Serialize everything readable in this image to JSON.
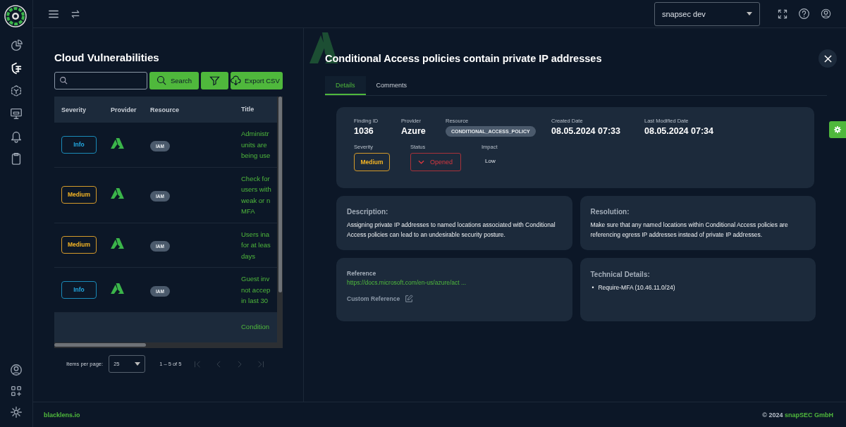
{
  "sidebar": {
    "items": [
      {
        "selected": false
      },
      {
        "selected": true
      },
      {
        "selected": false
      },
      {
        "selected": false
      },
      {
        "selected": false
      },
      {
        "selected": false
      }
    ]
  },
  "topbar": {
    "workspace": "snapsec dev"
  },
  "list": {
    "title": "Cloud Vulnerabilities",
    "search": {
      "button": "Search"
    },
    "export_button": "Export CSV",
    "columns": [
      "Severity",
      "Provider",
      "Resource",
      "Title"
    ],
    "rows": [
      {
        "severity": "Info",
        "kind": "info",
        "resource": "IAM",
        "title_lines": [
          "Administr",
          "units are",
          "being use"
        ],
        "selected": false
      },
      {
        "severity": "Medium",
        "kind": "medium",
        "resource": "IAM",
        "title_lines": [
          "Check for",
          "users with",
          "weak or n",
          "MFA"
        ],
        "selected": false
      },
      {
        "severity": "Medium",
        "kind": "medium",
        "resource": "IAM",
        "title_lines": [
          "Users ina",
          "for at leas",
          "days"
        ],
        "selected": false
      },
      {
        "severity": "Info",
        "kind": "info",
        "resource": "IAM",
        "title_lines": [
          "Guest inv",
          "not accep",
          "in last 30"
        ],
        "selected": false
      },
      {
        "title_lines": [
          "Condition"
        ],
        "selected": true
      }
    ],
    "pagination": {
      "label": "Items per page:",
      "page_size": "25",
      "range": "1 – 5 of 5",
      "disabled": true
    }
  },
  "detail": {
    "title": "Conditional Access policies contain private IP addresses",
    "tabs": [
      {
        "label": "Details",
        "selected": true
      },
      {
        "label": "Comments",
        "selected": false
      }
    ],
    "fields": [
      {
        "label": "Finding ID",
        "value": "1036",
        "kind": "big"
      },
      {
        "label": "Provider",
        "value": "Azure",
        "kind": "big"
      },
      {
        "label": "Resource",
        "value": "CONDITIONAL_ACCESS_POLICY",
        "kind": "pill"
      },
      {
        "label": "Created Date",
        "value": "08.05.2024 07:33",
        "kind": "big"
      },
      {
        "label": "Last Modified Date",
        "value": "08.05.2024 07:34",
        "kind": "big"
      }
    ],
    "fields_2": [
      {
        "label": "Severity",
        "value": "Medium",
        "kind": "medium"
      },
      {
        "label": "Status",
        "value": "Opened",
        "kind": "status"
      },
      {
        "label": "Impact",
        "value": "Low",
        "kind": "plain"
      }
    ],
    "description": {
      "heading": "Description:",
      "text": "Assigning private IP addresses to named locations associated with Conditional Access policies can lead to an undesirable security posture."
    },
    "resolution": {
      "heading": "Resolution:",
      "text": "Make sure that any named locations within Conditional Access policies are referencing egress IP addresses instead of private IP addresses."
    },
    "reference": {
      "heading": "Reference",
      "link": "https://docs.microsoft.com/en-us/azure/act ...",
      "custom": "Custom Reference"
    },
    "technical": {
      "heading": "Technical Details:",
      "items": [
        {
          "bullet": "•",
          "text": "Require-MFA (10.46.11.0/24)"
        }
      ]
    }
  },
  "footer": {
    "site": "blacklens.io",
    "copyright": "© 2024",
    "company": "snapSEC GmbH"
  }
}
